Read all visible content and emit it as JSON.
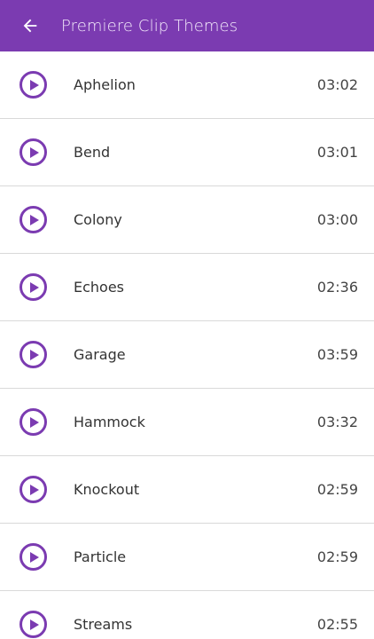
{
  "header": {
    "title": "Premiere Clip Themes",
    "back_icon": "arrow-left-icon"
  },
  "themes": [
    {
      "name": "Aphelion",
      "duration": "03:02"
    },
    {
      "name": "Bend",
      "duration": "03:01"
    },
    {
      "name": "Colony",
      "duration": "03:00"
    },
    {
      "name": "Echoes",
      "duration": "02:36"
    },
    {
      "name": "Garage",
      "duration": "03:59"
    },
    {
      "name": "Hammock",
      "duration": "03:32"
    },
    {
      "name": "Knockout",
      "duration": "02:59"
    },
    {
      "name": "Particle",
      "duration": "02:59"
    },
    {
      "name": "Streams",
      "duration": "02:55"
    }
  ],
  "icons": {
    "play": "play-circle-icon"
  },
  "colors": {
    "accent": "#7b3bb1",
    "header_text": "#f3e9fb",
    "divider": "#d9d9d9"
  }
}
